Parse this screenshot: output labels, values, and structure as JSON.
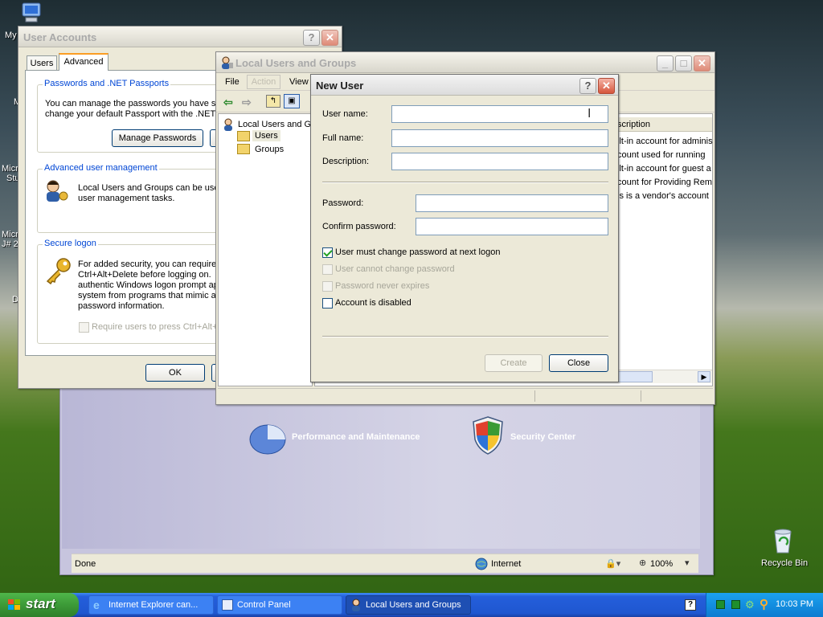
{
  "desktop": {
    "icons": [
      {
        "label": "My",
        "name": "my-computer"
      },
      {
        "label": "M",
        "name": "desktop-item-m"
      },
      {
        "label": "Micr",
        "name": "desktop-item-micr"
      },
      {
        "label": "Stu",
        "name": "desktop-item-stu"
      },
      {
        "label": "Micr",
        "name": "desktop-item-micr-2"
      },
      {
        "label": "J# 2",
        "name": "desktop-item-j2"
      },
      {
        "label": "D",
        "name": "desktop-item-d"
      },
      {
        "label": "Recycle Bin",
        "name": "recycle-bin"
      }
    ]
  },
  "user_accounts": {
    "title": "User Accounts",
    "tabs": [
      "Users",
      "Advanced"
    ],
    "passports_group": "Passwords and .NET Passports",
    "passports_text_1": "You can manage the passwords you have st",
    "passports_text_2": "change your default Passport with the .NET",
    "manage_passwords": "Manage Passwords",
    "advanced_group": "Advanced user management",
    "advanced_text_1": "Local Users and Groups can be used",
    "advanced_text_2": "user management tasks.",
    "secure_group": "Secure logon",
    "secure_text": [
      "For added security, you can require",
      "Ctrl+Alt+Delete before logging on.",
      "authentic Windows logon prompt ap",
      "system from programs that mimic a",
      "password information."
    ],
    "require_label": "Require users to press Ctrl+Alt+",
    "ok": "OK"
  },
  "control_panel": {
    "categories": [
      "Performance and Maintenance",
      "Security Center"
    ],
    "status": "Done",
    "zone": "Internet",
    "zoom": "100%"
  },
  "lusrmgr": {
    "title": "Local Users and Groups",
    "menu": [
      "File",
      "Action",
      "View"
    ],
    "tree_root": "Local Users and Gr",
    "tree_items": [
      "Users",
      "Groups"
    ],
    "desc_header": "scription",
    "desc_rows": [
      "ilt-in account for adminis",
      "count used for running",
      "ilt-in account for guest a",
      "count for Providing Rem",
      "is is a vendor's account"
    ]
  },
  "new_user": {
    "title": "New User",
    "user_name_label": "User name:",
    "full_name_label": "Full name:",
    "description_label": "Description:",
    "password_label": "Password:",
    "confirm_label": "Confirm password:",
    "user_name": "",
    "full_name": "",
    "description": "",
    "chk_must_change": "User must change password at next logon",
    "chk_cannot_change": "User cannot change password",
    "chk_never_expires": "Password never expires",
    "chk_disabled": "Account is disabled",
    "create": "Create",
    "close": "Close"
  },
  "taskbar": {
    "start": "start",
    "tasks": [
      "Internet Explorer can...",
      "Control Panel",
      "Local Users and Groups"
    ],
    "clock": "10:03 PM"
  }
}
